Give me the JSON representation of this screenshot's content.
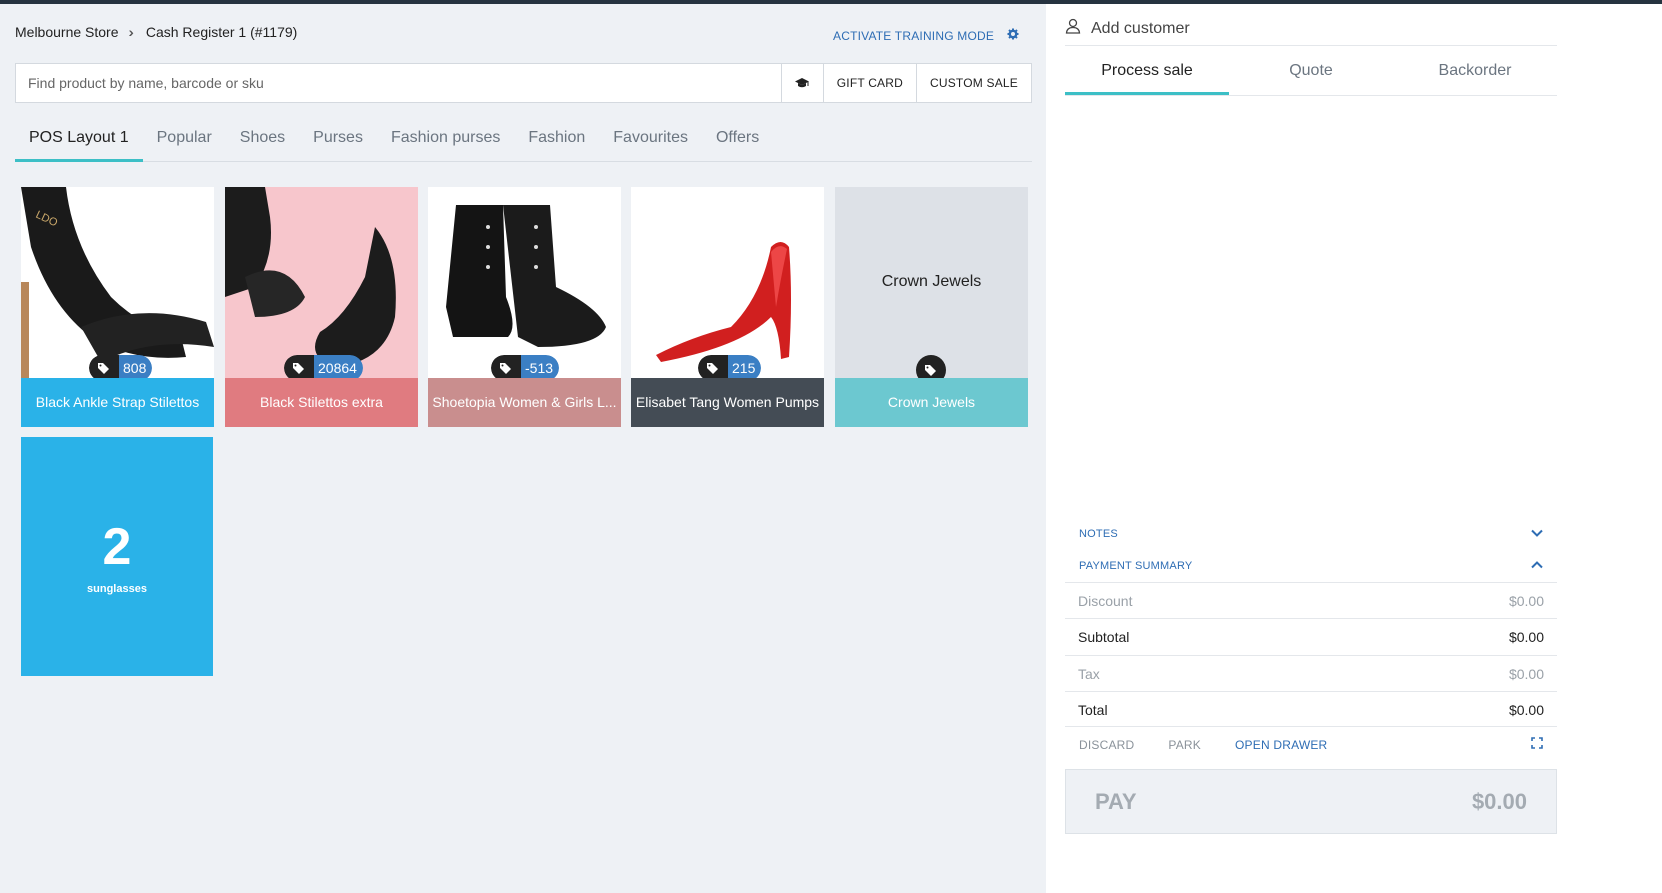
{
  "breadcrumb": {
    "store": "Melbourne Store",
    "register": "Cash Register 1 (#1179)"
  },
  "header": {
    "training_label": "ACTIVATE TRAINING MODE"
  },
  "search": {
    "placeholder": "Find product by name, barcode or sku",
    "gift_card_label": "GIFT CARD",
    "custom_sale_label": "CUSTOM SALE"
  },
  "tabs": [
    {
      "label": "POS Layout 1"
    },
    {
      "label": "Popular"
    },
    {
      "label": "Shoes"
    },
    {
      "label": "Purses"
    },
    {
      "label": "Fashion purses"
    },
    {
      "label": "Fashion"
    },
    {
      "label": "Favourites"
    },
    {
      "label": "Offers"
    }
  ],
  "products": [
    {
      "name": "Black Ankle Strap Stilettos",
      "stock": "808",
      "color": "#2ab2e8"
    },
    {
      "name": "Black Stilettos extra",
      "stock": "20864",
      "color": "#e07b80"
    },
    {
      "name": "Shoetopia Women & Girls L...",
      "stock": "-513",
      "color": "#c98e8e"
    },
    {
      "name": "Elisabet Tang Women Pumps",
      "stock": "215",
      "color": "#444c55"
    },
    {
      "name": "Crown Jewels",
      "image_text": "Crown Jewels",
      "color": "#6cc8d0"
    }
  ],
  "folder_tile": {
    "count": "2",
    "label": "sunglasses",
    "color": "#2ab2e8"
  },
  "sidebar": {
    "add_customer": "Add customer",
    "tabs": [
      {
        "label": "Process sale"
      },
      {
        "label": "Quote"
      },
      {
        "label": "Backorder"
      }
    ],
    "notes_label": "NOTES",
    "payment_summary_label": "PAYMENT SUMMARY",
    "summary": {
      "discount_label": "Discount",
      "discount_value": "$0.00",
      "subtotal_label": "Subtotal",
      "subtotal_value": "$0.00",
      "tax_label": "Tax",
      "tax_value": "$0.00",
      "total_label": "Total",
      "total_value": "$0.00"
    },
    "actions": {
      "discard": "DISCARD",
      "park": "PARK",
      "open_drawer": "OPEN DRAWER"
    },
    "pay": {
      "label": "PAY",
      "amount": "$0.00"
    }
  },
  "colors": {
    "accent": "#3cbfc6",
    "link": "#2e6db4",
    "stock_badge": "#3b7fc4"
  }
}
